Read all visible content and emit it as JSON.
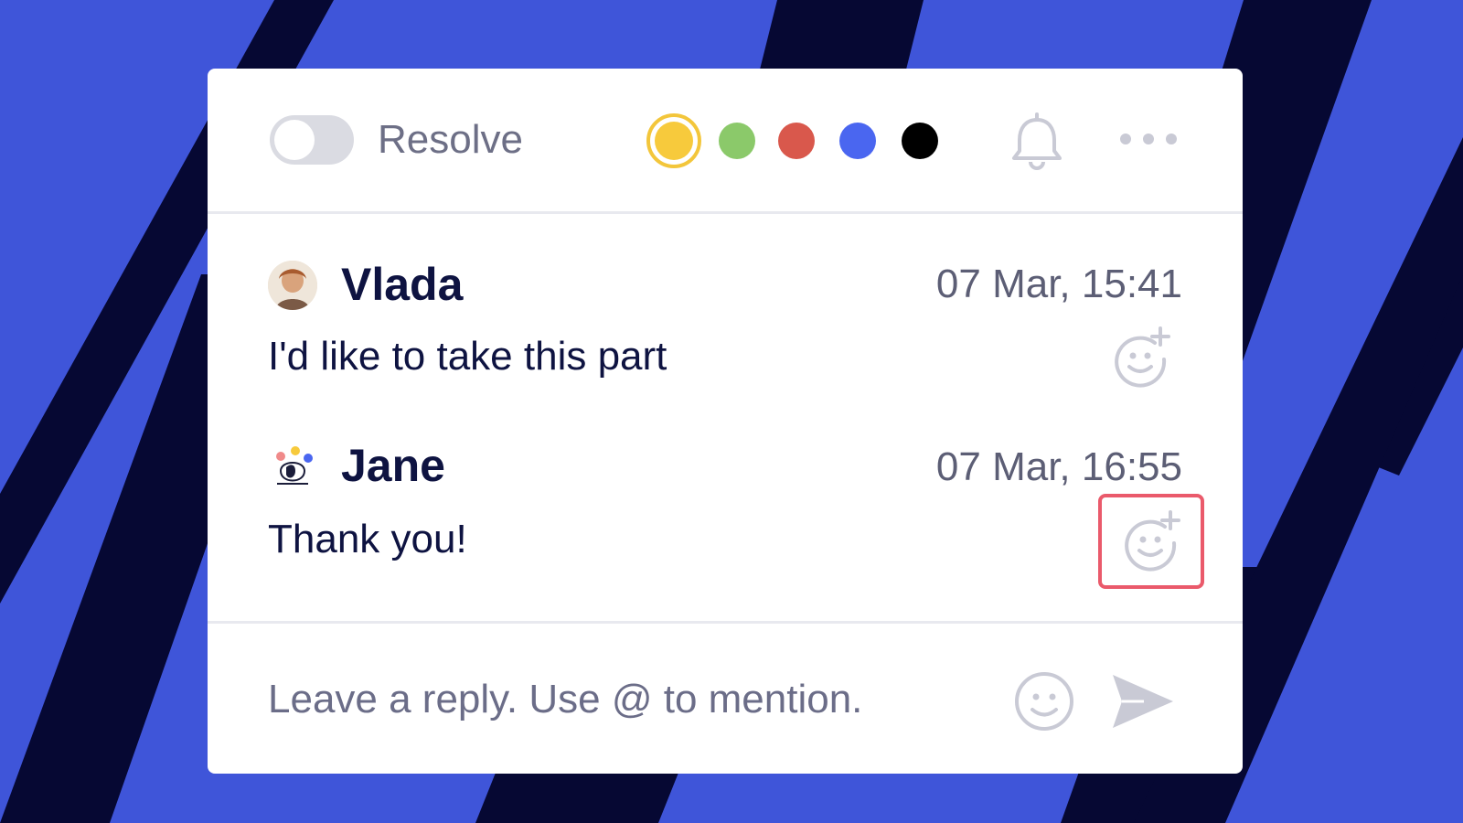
{
  "colors": {
    "background": "#3f55d9",
    "stripe": "#060833",
    "card": "#ffffff",
    "highlight": "#ea5a6b",
    "text_primary": "#0e1341",
    "text_secondary": "#6d6f86"
  },
  "toolbar": {
    "resolve_toggle": {
      "on": false
    },
    "resolve_label": "Resolve",
    "color_swatches": [
      {
        "name": "yellow",
        "color": "#f7ca3c",
        "selected": true
      },
      {
        "name": "green",
        "color": "#8bc96a",
        "selected": false
      },
      {
        "name": "red",
        "color": "#d9584c",
        "selected": false
      },
      {
        "name": "blue",
        "color": "#4a66f0",
        "selected": false
      },
      {
        "name": "black",
        "color": "#000000",
        "selected": false
      }
    ],
    "notification_icon": "bell-icon",
    "more_icon": "more-horizontal-icon"
  },
  "messages": [
    {
      "author": "Vlada",
      "time": "07 Mar, 15:41",
      "text": "I'd like to take this part",
      "avatar": "photo-avatar",
      "reaction_icon": "add-reaction-icon"
    },
    {
      "author": "Jane",
      "time": "07 Mar, 16:55",
      "text": "Thank you!",
      "avatar": "illustration-avatar",
      "reaction_icon": "add-reaction-icon",
      "reaction_highlighted": true
    }
  ],
  "reply": {
    "placeholder": "Leave a reply. Use @ to mention.",
    "emoji_icon": "smiley-icon",
    "send_icon": "send-icon"
  }
}
